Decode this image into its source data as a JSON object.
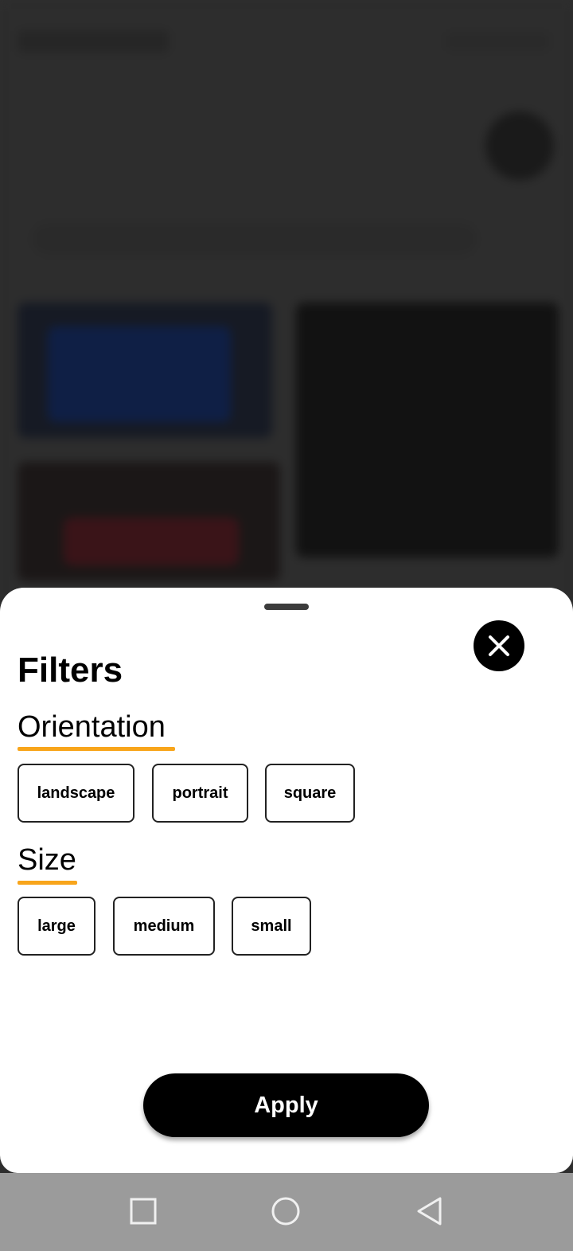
{
  "sheet": {
    "title": "Filters",
    "close_icon": "close-icon",
    "sections": [
      {
        "label": "Orientation",
        "options": [
          "landscape",
          "portrait",
          "square"
        ]
      },
      {
        "label": "Size",
        "options": [
          "large",
          "medium",
          "small"
        ]
      }
    ],
    "apply_label": "Apply",
    "accent_color": "#f8a51b"
  },
  "navbar": {
    "icons": [
      "recent-apps-icon",
      "home-icon",
      "back-icon"
    ]
  }
}
